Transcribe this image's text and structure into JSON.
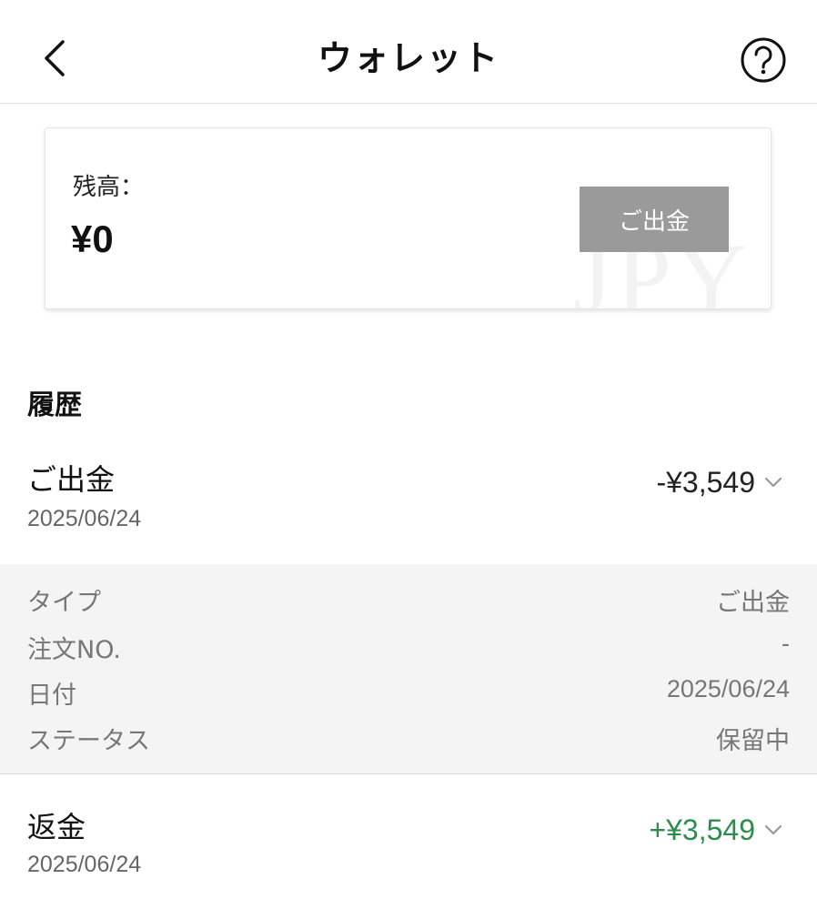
{
  "header": {
    "title": "ウォレット",
    "back_icon": "chevron-left-icon",
    "help_icon": "question-circle-icon"
  },
  "balance_card": {
    "label": "残高：",
    "value": "¥0",
    "withdraw_button": "ご出金",
    "watermark": "JPY"
  },
  "history": {
    "title": "履歴",
    "items": [
      {
        "title": "ご出金",
        "date": "2025/06/24",
        "amount": "-¥3,549",
        "amount_color": "#222222",
        "expanded": true,
        "details": [
          {
            "label": "タイプ",
            "value": "ご出金"
          },
          {
            "label": "注文NO.",
            "value": "-"
          },
          {
            "label": "日付",
            "value": "2025/06/24"
          },
          {
            "label": "ステータス",
            "value": "保留中"
          }
        ]
      },
      {
        "title": "返金",
        "date": "2025/06/24",
        "amount": "+¥3,549",
        "amount_color": "#2c8e4d",
        "expanded": false
      }
    ]
  },
  "colors": {
    "positive": "#2c8e4d",
    "button_bg": "#9a9a9a",
    "detail_bg": "#f4f4f4"
  }
}
